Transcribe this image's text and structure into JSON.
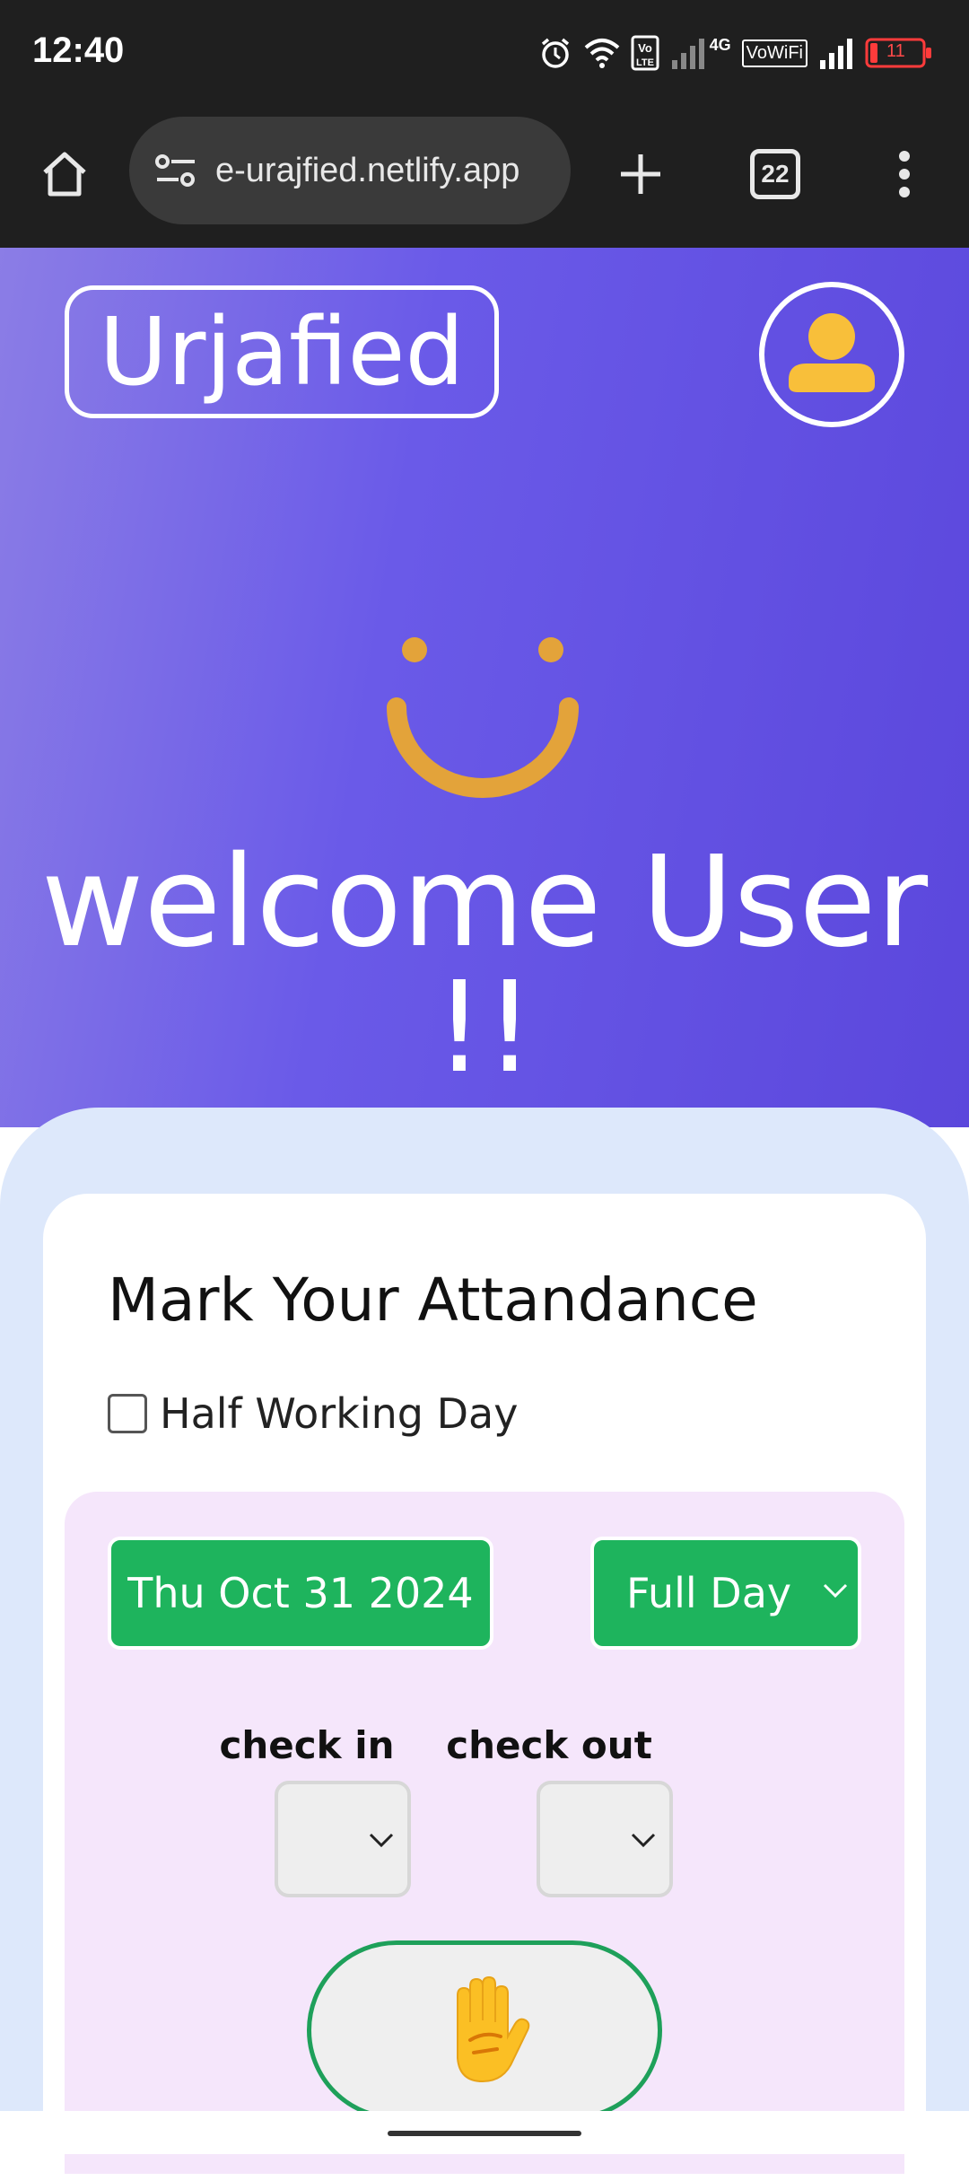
{
  "status_bar": {
    "time": "12:40",
    "battery_level": "11",
    "network_label": "4G",
    "vowifi_label": "VoWiFi",
    "volte_label": "Vo LTE",
    "icons": [
      "alarm-icon",
      "wifi-icon",
      "volte-icon",
      "signal-icon",
      "vowifi-icon",
      "signal-icon",
      "battery-icon"
    ]
  },
  "browser": {
    "url": "e-urajfied.netlify.app",
    "tab_count": "22",
    "icons": [
      "home-icon",
      "site-info-icon",
      "new-tab-icon",
      "tab-switcher-icon",
      "menu-icon"
    ]
  },
  "header": {
    "logo": "Urjafied",
    "avatar_icon": "user-icon"
  },
  "hero": {
    "smile_icon": "smile-icon",
    "welcome_text": "welcome User !!"
  },
  "attendance": {
    "title": "Mark Your Attandance",
    "half_day_label": "Half Working Day",
    "half_day_checked": false,
    "date": "Thu Oct 31 2024",
    "day_type": "Full Day",
    "check_in_label": "check in",
    "check_out_label": "check out",
    "check_in_value": "",
    "check_out_value": "",
    "mark_button_icon": "raised-hand-icon"
  },
  "colors": {
    "hero_gradient_start": "#8b7de6",
    "hero_gradient_end": "#5b47dc",
    "accent_green": "#1eb45d",
    "smile_orange": "#e3a33a",
    "avatar_yellow": "#f8bf3a",
    "panel_pink": "#f5e6fb",
    "outer_blue": "#dde8fb"
  }
}
